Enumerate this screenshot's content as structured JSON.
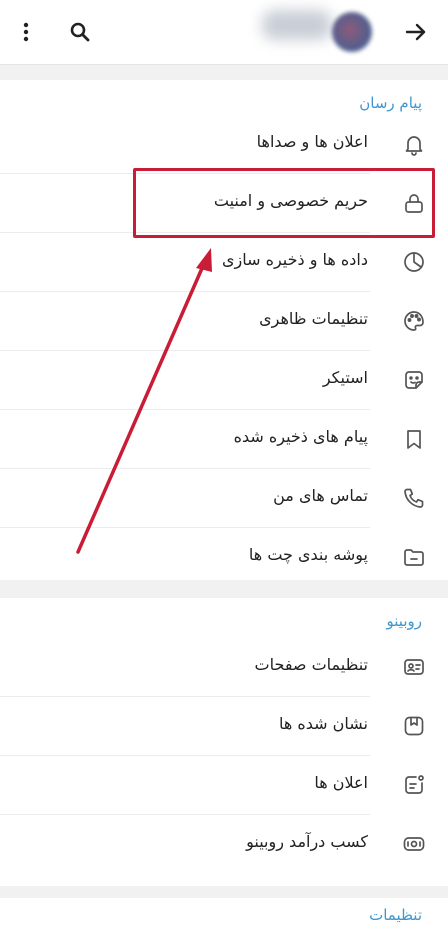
{
  "colors": {
    "accent": "#3e97cf",
    "highlight": "#c91c36",
    "icon": "#555555",
    "text": "#222222"
  },
  "topbar": {
    "icons": [
      "more-vertical-icon",
      "search-icon",
      "arrow-right-icon"
    ]
  },
  "sections": [
    {
      "title": "پیام رسان",
      "items": [
        {
          "label": "اعلان ها و صداها",
          "icon": "bell-icon"
        },
        {
          "label": "حریم خصوصی و امنیت",
          "icon": "lock-icon"
        },
        {
          "label": "داده ها و ذخیره سازی",
          "icon": "pie-chart-icon"
        },
        {
          "label": "تنظیمات ظاهری",
          "icon": "palette-icon"
        },
        {
          "label": "استیکر",
          "icon": "sticker-icon"
        },
        {
          "label": "پیام های ذخیره شده",
          "icon": "bookmark-icon"
        },
        {
          "label": "تماس های من",
          "icon": "phone-icon"
        },
        {
          "label": "پوشه بندی چت ها",
          "icon": "folder-icon"
        }
      ]
    },
    {
      "title": "روبینو",
      "items": [
        {
          "label": "تنظیمات صفحات",
          "icon": "profile-card-icon"
        },
        {
          "label": "نشان شده ها",
          "icon": "bookmark-square-icon"
        },
        {
          "label": "اعلان ها",
          "icon": "notification-icon"
        },
        {
          "label": "کسب درآمد روبینو",
          "icon": "money-icon"
        }
      ]
    },
    {
      "title": "تنظیمات",
      "items": []
    }
  ]
}
